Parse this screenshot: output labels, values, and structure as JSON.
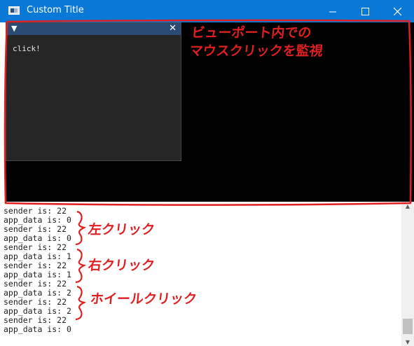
{
  "window": {
    "title": "Custom Title",
    "minimize_icon": "minimize-icon",
    "maximize_icon": "maximize-icon",
    "close_icon": "close-icon"
  },
  "imgui": {
    "collapse_glyph": "▼",
    "close_glyph": "✕",
    "text": "click!"
  },
  "console": {
    "lines": [
      "sender is: 22",
      "app_data is: 0",
      "sender is: 22",
      "app_data is: 0",
      "sender is: 22",
      "app_data is: 1",
      "sender is: 22",
      "app_data is: 1",
      "sender is: 22",
      "app_data is: 2",
      "sender is: 22",
      "app_data is: 2",
      "sender is: 22",
      "app_data is: 0"
    ]
  },
  "annotations": {
    "viewport_line1": "ビューポート内での",
    "viewport_line2": "マウスクリックを監視",
    "left_click": "左クリック",
    "right_click": "右クリック",
    "wheel_click": "ホイールクリック",
    "color": "#e02020"
  },
  "colors": {
    "titlebar": "#0a78d7",
    "viewport": "#000000",
    "imgui_title": "#2a4c74",
    "imgui_bg": "#262626"
  }
}
